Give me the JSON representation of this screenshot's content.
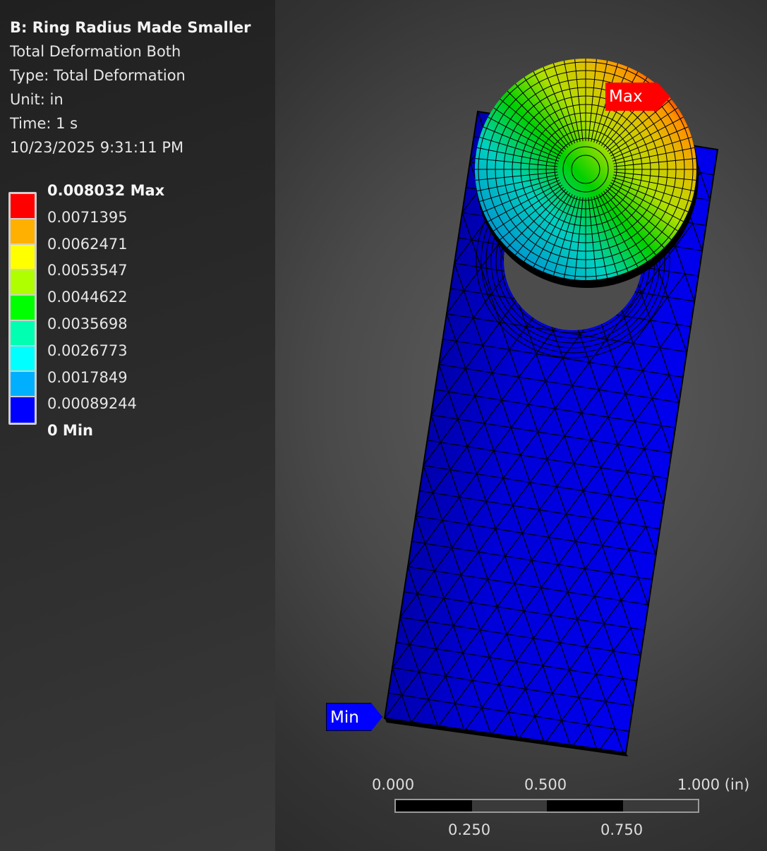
{
  "info": {
    "title": "B: Ring Radius Made Smaller",
    "result_name": "Total Deformation Both",
    "type": "Type: Total Deformation",
    "unit": "Unit: in",
    "time": "Time: 1 s",
    "timestamp": "10/23/2025 9:31:11 PM"
  },
  "legend": {
    "labels": [
      "0.008032 Max",
      "0.0071395",
      "0.0062471",
      "0.0053547",
      "0.0044622",
      "0.0035698",
      "0.0026773",
      "0.0017849",
      "0.00089244",
      "0 Min"
    ],
    "colors": [
      "#ff0000",
      "#ffb000",
      "#ffff00",
      "#b0ff00",
      "#00ff00",
      "#00ffb0",
      "#00ffff",
      "#00b0ff",
      "#0000ff"
    ]
  },
  "probes": {
    "max": "Max",
    "min": "Min"
  },
  "scale_bar": {
    "top_labels": [
      "0.000",
      "0.500",
      "1.000 (in)"
    ],
    "bottom_labels": [
      "0.250",
      "0.750"
    ]
  }
}
